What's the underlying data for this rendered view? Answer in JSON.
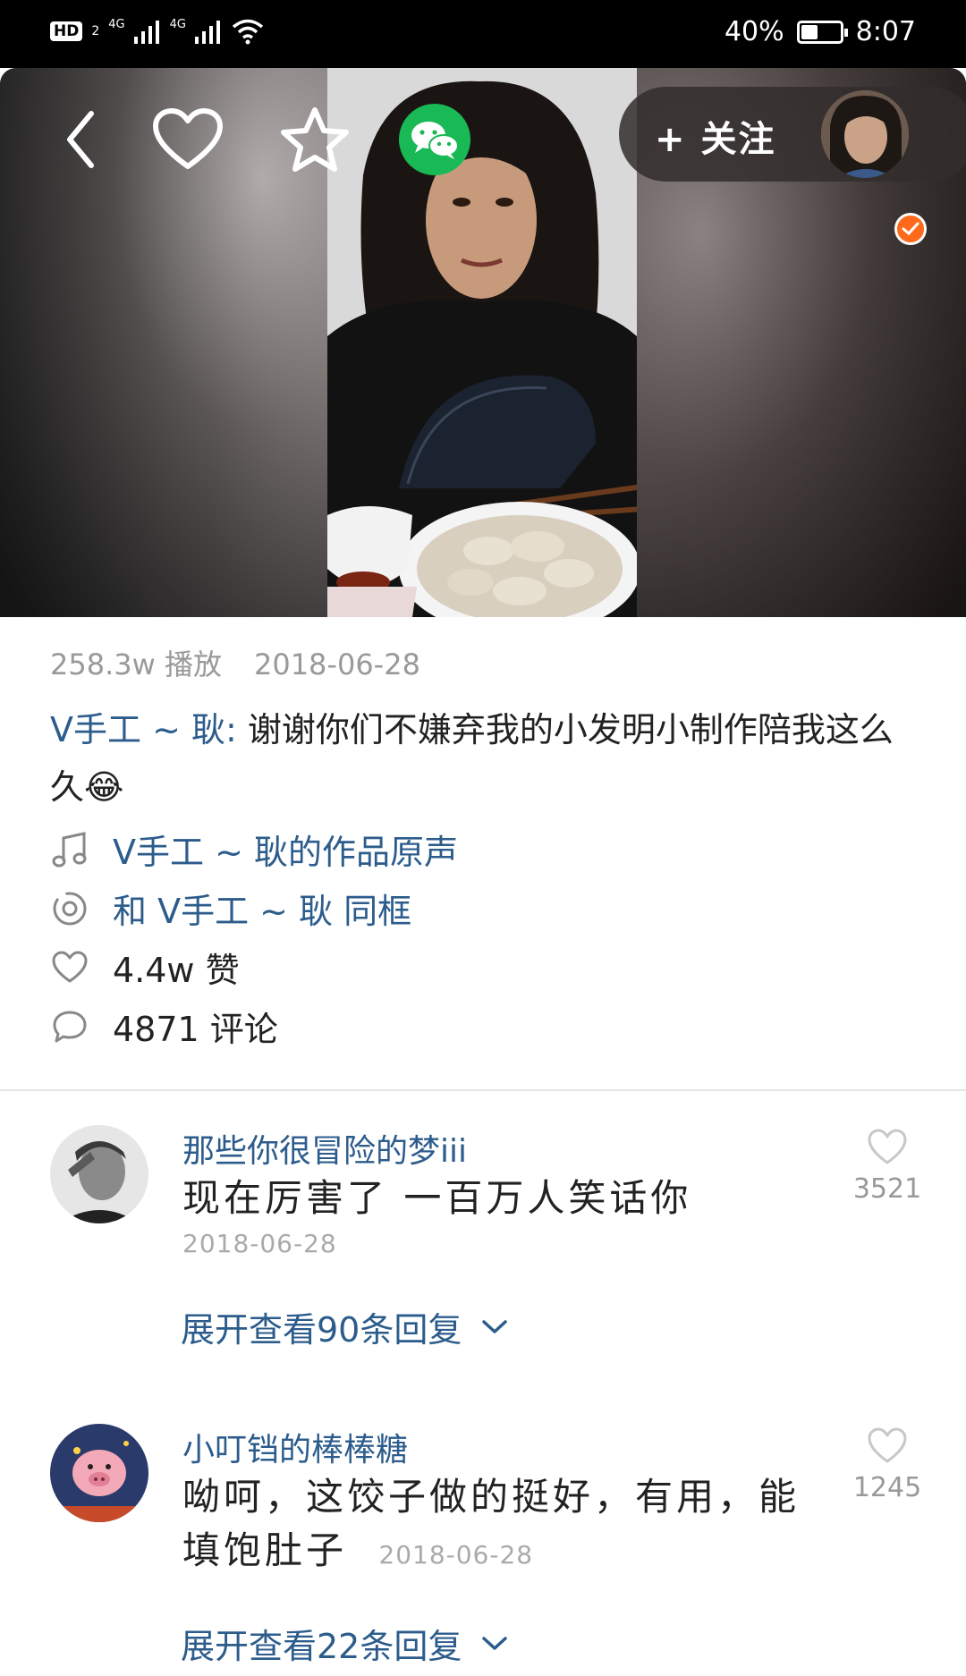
{
  "status_bar": {
    "hd_label": "HD",
    "hd_sub": "2",
    "net1": "4G",
    "net2": "4G",
    "battery": "40%",
    "battery_level": 0.4,
    "time": "8:07"
  },
  "video": {
    "follow_label": "+ 关注"
  },
  "info": {
    "plays": "258.3w 播放",
    "date": "2018-06-28",
    "author": "V手工 ~ 耿:",
    "caption": " 谢谢你们不嫌弃我的小发明小制作陪我这么久",
    "caption_emoji": "😂",
    "music": "V手工 ~ 耿的作品原声",
    "duet": "和 V手工 ~ 耿 同框",
    "likes": "4.4w 赞",
    "comments": "4871 评论"
  },
  "comments": [
    {
      "user": "那些你很冒险的梦iii",
      "text": "现在厉害了  一百万人笑话你",
      "date": "2018-06-28",
      "likes": "3521",
      "more": "展开查看90条回复"
    },
    {
      "user": "小叮铛的棒棒糖",
      "text": "呦呵，这饺子做的挺好，有用，能填饱肚子",
      "date": "2018-06-28",
      "likes": "1245",
      "more": "展开查看22条回复"
    }
  ],
  "colors": {
    "link": "#2c5c8c",
    "wechat": "#19b955",
    "verify": "#ff6a1a"
  }
}
